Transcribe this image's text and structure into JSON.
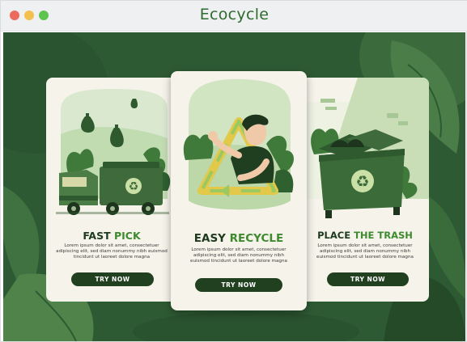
{
  "window": {
    "title": "Ecocycle",
    "controls": [
      "close",
      "minimize",
      "zoom"
    ]
  },
  "colors": {
    "background": "#2f5c34",
    "card": "#f6f4ea",
    "dark_green": "#21401f",
    "accent_green": "#3e8a2f",
    "heading": "#1d3a1f"
  },
  "cards": [
    {
      "illustration": "garbage-truck-with-falling-bags",
      "title_part1": "FAST",
      "title_part2": "PICK",
      "description": "Lorem ipsum dolor sit amet, consectetuer adipiscing elit, sed diam nonummy nibh euismod tincidunt ut laoreet dolore magna",
      "button": "TRY NOW"
    },
    {
      "illustration": "person-with-recycle-symbol",
      "title_part1": "EASY",
      "title_part2": "RECYCLE",
      "description": "Lorem ipsum dolor sit amet, consectetuer adipiscing elit, sed diam nonummy nibh euismod tincidunt ut laoreet dolore magna",
      "button": "TRY NOW"
    },
    {
      "illustration": "recycling-dumpster",
      "title_part1": "PLACE",
      "title_part2": "THE TRASH",
      "description": "Lorem ipsum dolor sit amet, consectetuer adipiscing elit, sed diam nonummy nibh euismod tincidunt ut laoreet dolore magna",
      "button": "TRY NOW"
    }
  ]
}
